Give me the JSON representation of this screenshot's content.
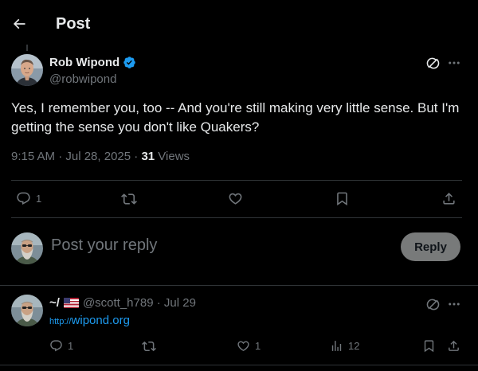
{
  "header": {
    "title": "Post"
  },
  "post": {
    "author_name": "Rob Wipond",
    "author_handle": "@robwipond",
    "text": "Yes, I remember you, too -- And you're still making very little sense. But I'm getting the sense you don't like Quakers?",
    "time": "9:15 AM · Jul 28, 2025 · ",
    "views_count": "31",
    "views_label": " Views",
    "reply_count": "1"
  },
  "composer": {
    "placeholder": "Post your reply",
    "button_label": "Reply"
  },
  "reply": {
    "name": "~/",
    "handle": "@scott_h789",
    "separator": " · ",
    "date": "Jul 29",
    "link_proto": "http://",
    "link_domain": "wipond.org",
    "reply_count": "1",
    "like_count": "1",
    "views_count": "12"
  },
  "colors": {
    "background": "#000000",
    "text": "#e7e9ea",
    "muted": "#71767b",
    "link": "#1d9bf0",
    "verified": "#1d9bf0",
    "divider": "#2f3336"
  },
  "icons": [
    "back-arrow-icon",
    "verified-badge-icon",
    "grok-icon",
    "more-icon",
    "reply-icon",
    "repost-icon",
    "like-icon",
    "bookmark-icon",
    "share-icon",
    "views-icon",
    "flag-us-icon"
  ]
}
